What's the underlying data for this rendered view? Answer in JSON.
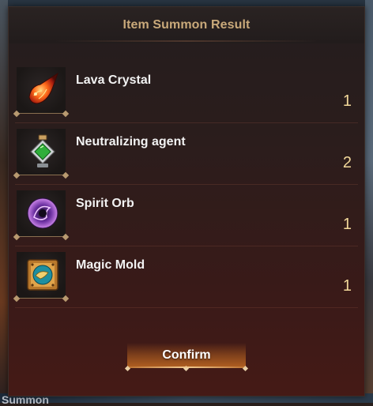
{
  "background": {
    "bottom_label": "Summon"
  },
  "dialog": {
    "title": "Item Summon Result",
    "items": [
      {
        "name": "Lava Crystal",
        "quantity": "1",
        "icon": "lava-crystal-icon"
      },
      {
        "name": "Neutralizing agent",
        "quantity": "2",
        "icon": "potion-bottle-icon"
      },
      {
        "name": "Spirit Orb",
        "quantity": "1",
        "icon": "spirit-orb-icon"
      },
      {
        "name": "Magic Mold",
        "quantity": "1",
        "icon": "magic-mold-icon"
      }
    ],
    "confirm_label": "Confirm"
  },
  "colors": {
    "title": "#c9a97a",
    "quantity": "#f2d89a",
    "item_name": "#f2f2f2",
    "confirm_glow": "#c86e23"
  }
}
